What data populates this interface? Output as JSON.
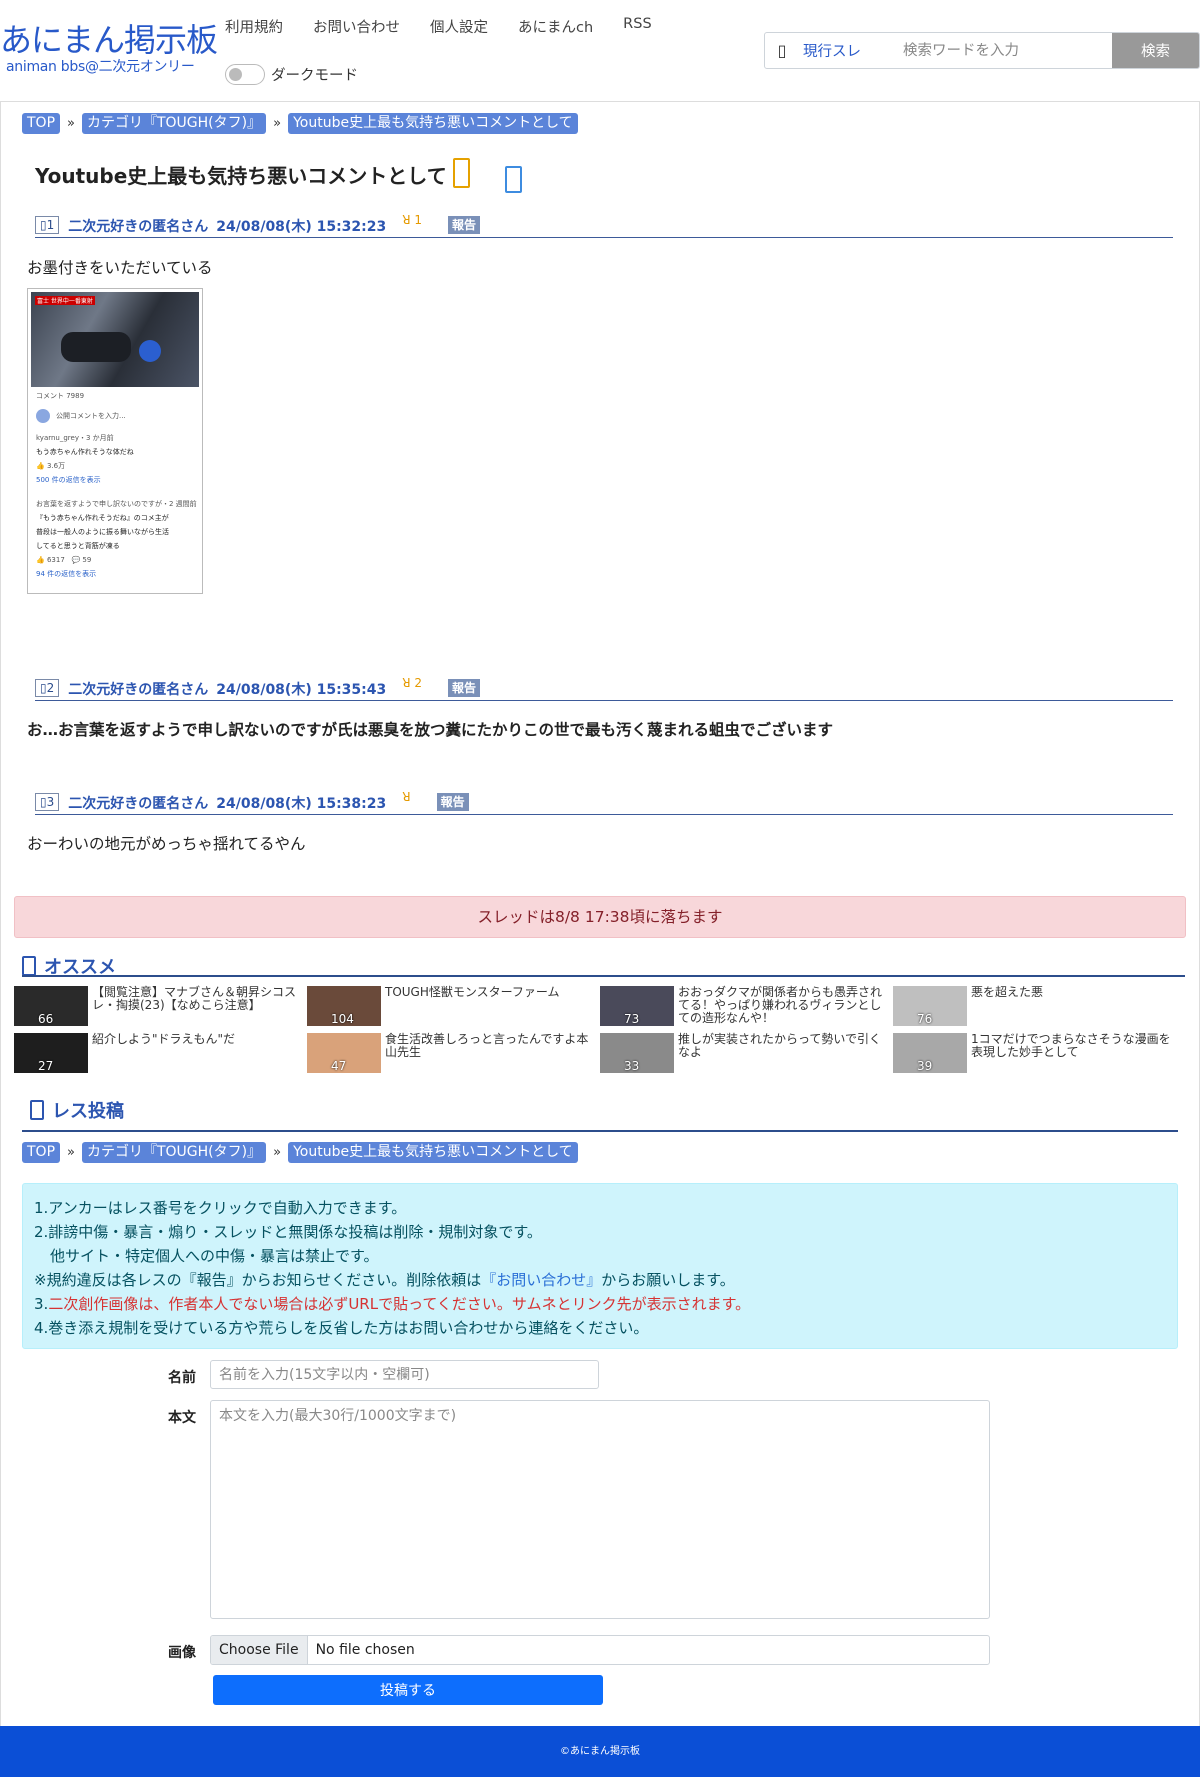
{
  "header": {
    "logo_main": "あにまん掲示板",
    "logo_sub": "animan bbs@二次元オンリー",
    "nav": [
      "利用規約",
      "お問い合わせ",
      "個人設定",
      "あにまんch",
      "RSS"
    ],
    "dark_mode_label": "ダークモード",
    "search": {
      "scope": "現行スレ",
      "placeholder": "検索ワードを入力",
      "button": "検索"
    }
  },
  "breadcrumb": [
    "TOP",
    "カテゴリ『TOUGH(タフ)』",
    "Youtube史上最も気持ち悪いコメントとして"
  ],
  "thread": {
    "title": "Youtube史上最も気持ち悪いコメントとして",
    "posts": [
      {
        "num": "1",
        "name": "二次元好きの匿名さん",
        "date": "24/08/08(木) 15:32:23",
        "reply_count": "1",
        "report": "報告",
        "body": "お墨付きをいただいている"
      },
      {
        "num": "2",
        "name": "二次元好きの匿名さん",
        "date": "24/08/08(木) 15:35:43",
        "reply_count": "2",
        "report": "報告",
        "body": "お…お言葉を返すようで申し訳ないのですが氏は悪臭を放つ糞にたかりこの世で最も汚く蔑まれる蛆虫でございます"
      },
      {
        "num": "3",
        "name": "二次元好きの匿名さん",
        "date": "24/08/08(木) 15:38:23",
        "reply_count": "",
        "report": "報告",
        "body": "おーわいの地元がめっちゃ揺れてるやん"
      }
    ],
    "image": {
      "video_tag": "富士 世界中一番東射",
      "comments_header": "コメント 7989",
      "comment_placeholder": "公開コメントを入力...",
      "c1_user": "kyarnu_grey・3 か月前",
      "c1_text": "もう赤ちゃん作れそうな体だね",
      "c1_likes": "3.6万",
      "c1_replies": "500 件の返信を表示",
      "c2_user": "お言葉を返すようで申し訳ないのですが・2 週間前",
      "c2_text1": "『もう赤ちゃん作れそうだね』のコメ主が",
      "c2_text2": "普段は一般人のように振る舞いながら生活",
      "c2_text3": "してると思うと背筋が凍る",
      "c2_likes": "6317",
      "c2_dislikes": "59",
      "c2_replies": "94 件の返信を表示"
    }
  },
  "drop_notice": "スレッドは8/8 17:38頃に落ちます",
  "recommend": {
    "heading": "オススメ",
    "items": [
      {
        "title": "【閲覧注意】マナブさん＆朝昇シコスレ・掏摸(23)【なめこら注意】",
        "count": "66",
        "color": "#2a2a2a"
      },
      {
        "title": "TOUGH怪獣モンスターファーム",
        "count": "104",
        "color": "#6a4a3a"
      },
      {
        "title": "おおっダクマが関係者からも愚弄されてる！やっぱり嫌われるヴィランとしての造形なんや！",
        "count": "73",
        "color": "#4a4a5a"
      },
      {
        "title": "悪を超えた悪",
        "count": "76",
        "color": "#bfbfbf"
      },
      {
        "title": "紹介しよう\"ドラえもん\"だ",
        "count": "27",
        "color": "#1e1e1e"
      },
      {
        "title": "食生活改善しろっと言ったんですよ本山先生",
        "count": "47",
        "color": "#d9a27a"
      },
      {
        "title": "推しが実装されたからって勢いで引くなよ",
        "count": "33",
        "color": "#8a8a8a"
      },
      {
        "title": "1コマだけでつまらなさそうな漫画を表現した妙手として",
        "count": "39",
        "color": "#a8a8a8"
      }
    ]
  },
  "reply_section": {
    "heading": "レス投稿",
    "rules": {
      "line1": "1.アンカーはレス番号をクリックで自動入力できます。",
      "line2": "2.誹謗中傷・暴言・煽り・スレッドと無関係な投稿は削除・規制対象です。",
      "line2b": "他サイト・特定個人への中傷・暴言は禁止です。",
      "line3a": "※規約違反は各レスの『報告』からお知らせください。削除依頼は",
      "line3link": "『お問い合わせ』",
      "line3b": "からお願いします。",
      "line4num": "3.",
      "line4red": "二次創作画像は、作者本人でない場合は必ずURLで貼ってください。サムネとリンク先が表示されます。",
      "line5": "4.巻き添え規制を受けている方や荒らしを反省した方はお問い合わせから連絡をください。"
    },
    "form": {
      "name_label": "名前",
      "name_placeholder": "名前を入力(15文字以内・空欄可)",
      "body_label": "本文",
      "body_placeholder": "本文を入力(最大30行/1000文字まで)",
      "image_label": "画像",
      "file_button": "Choose File",
      "file_status": "No file chosen",
      "submit": "投稿する"
    }
  },
  "footer": "©あにまん掲示板"
}
